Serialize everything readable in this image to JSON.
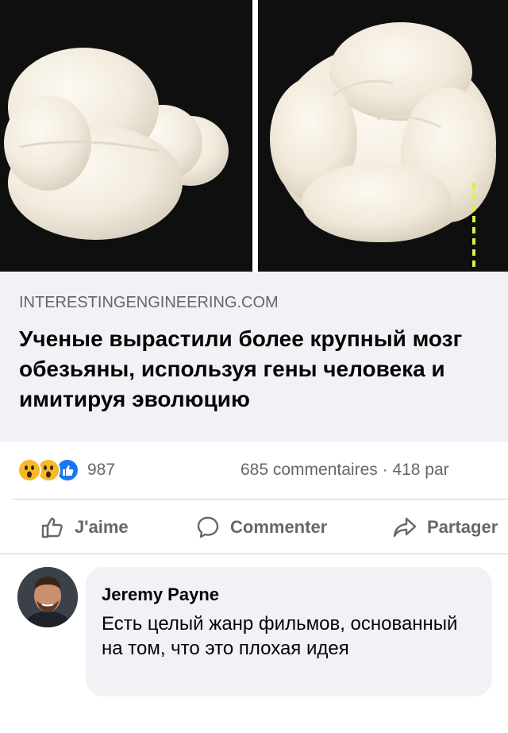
{
  "post": {
    "link_domain": "INTERESTINGENGINEERING.COM",
    "link_title": "Ученые вырастили более крупный мозг обезьяны, используя гены человека и имитируя эволюцию"
  },
  "stats": {
    "reactions": [
      "wow-icon",
      "wow-icon",
      "like-icon"
    ],
    "reaction_count": "987",
    "comments_shares": "685 commentaires · 418 par"
  },
  "actions": {
    "like_label": "J'aime",
    "comment_label": "Commenter",
    "share_label": "Partager"
  },
  "comment": {
    "author": "Jeremy Payne",
    "text": "Есть целый жанр фильмов, основанный на том, что это плохая идея"
  },
  "colors": {
    "like_blue": "#1877f2",
    "wow_yellow": "#f7b928",
    "text_secondary": "#65676b",
    "preview_bg": "#f0f2f5",
    "ruler_yellow": "#d9f04a"
  }
}
